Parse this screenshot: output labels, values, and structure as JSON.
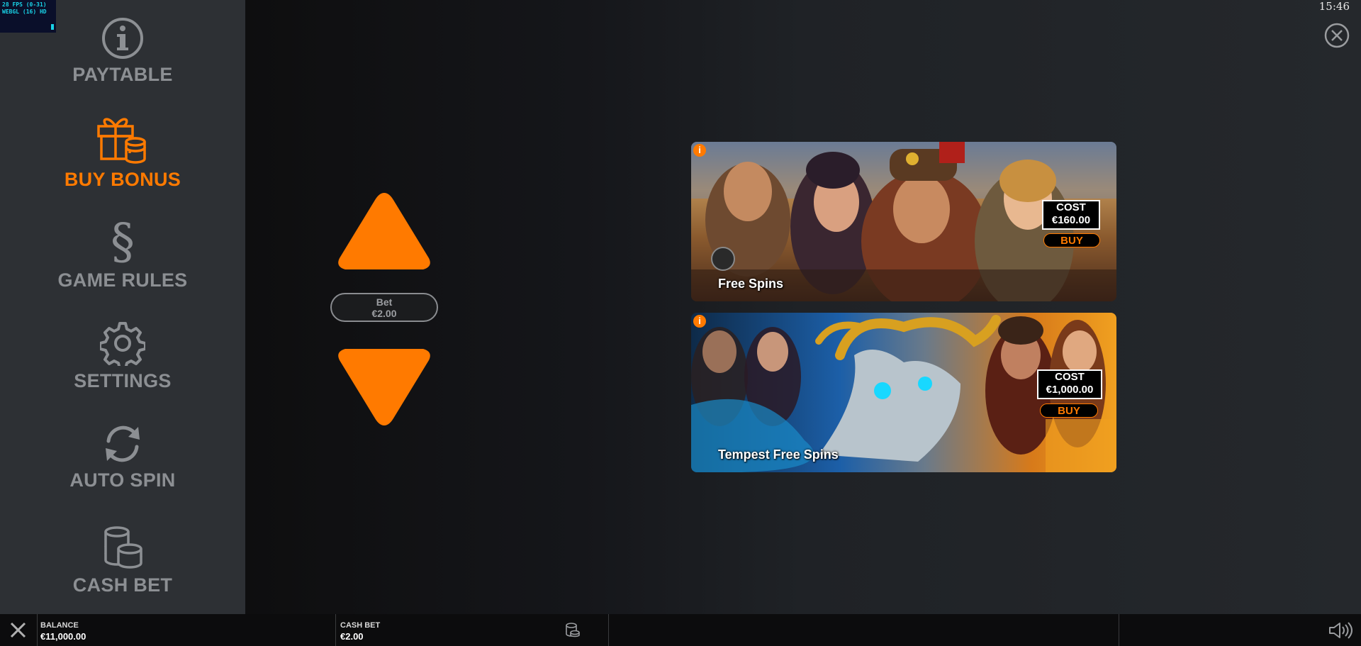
{
  "debug": {
    "line1": "28 FPS (0-31)",
    "line2": "WEBGL (16) HD"
  },
  "clock": "15:46",
  "sidebar": {
    "items": [
      {
        "label": "PAYTABLE",
        "icon": "info-icon",
        "active": false
      },
      {
        "label": "BUY BONUS",
        "icon": "gift-coins-icon",
        "active": true
      },
      {
        "label": "GAME RULES",
        "icon": "section-sign-icon",
        "active": false
      },
      {
        "label": "SETTINGS",
        "icon": "gear-icon",
        "active": false
      },
      {
        "label": "AUTO SPIN",
        "icon": "refresh-icon",
        "active": false
      },
      {
        "label": "CASH BET",
        "icon": "coin-stack-icon",
        "active": false
      }
    ]
  },
  "bet": {
    "label": "Bet",
    "value": "€2.00"
  },
  "bonuses": [
    {
      "title": "Free Spins",
      "cost_label": "COST",
      "cost": "€160.00",
      "buy_label": "BUY",
      "info": "i"
    },
    {
      "title": "Tempest Free Spins",
      "cost_label": "COST",
      "cost": "€1,000.00",
      "buy_label": "BUY",
      "info": "i"
    }
  ],
  "bottombar": {
    "balance_label": "BALANCE",
    "balance_value": "€11,000.00",
    "cashbet_label": "CASH BET",
    "cashbet_value": "€2.00"
  },
  "colors": {
    "accent": "#ff7a00",
    "sidebar_bg": "#2d3034",
    "menu_text": "#8c8f93"
  }
}
